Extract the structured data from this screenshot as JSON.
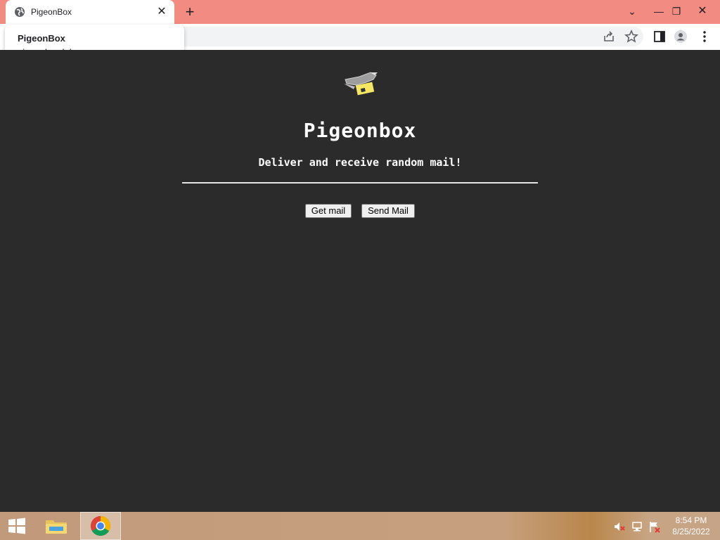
{
  "browser": {
    "tab_title": "PigeonBox",
    "tab_close": "✕",
    "new_tab": "+",
    "window_controls": {
      "chevron": "⌄",
      "minimize": "—",
      "restore": "❐",
      "close": "✕"
    }
  },
  "hover_card": {
    "title": "PigeonBox",
    "url": "pigeonbox.lol"
  },
  "page": {
    "logo_icon": "pigeon-mail-icon",
    "heading": "Pigeonbox",
    "tagline": "Deliver and receive random mail!",
    "buttons": {
      "get_mail": "Get mail",
      "send_mail": "Send Mail"
    }
  },
  "taskbar": {
    "time": "8:54 PM",
    "date": "8/25/2022"
  },
  "colors": {
    "titlebar": "#f28b82",
    "page_background": "#2b2b2b",
    "text": "#ffffff"
  }
}
